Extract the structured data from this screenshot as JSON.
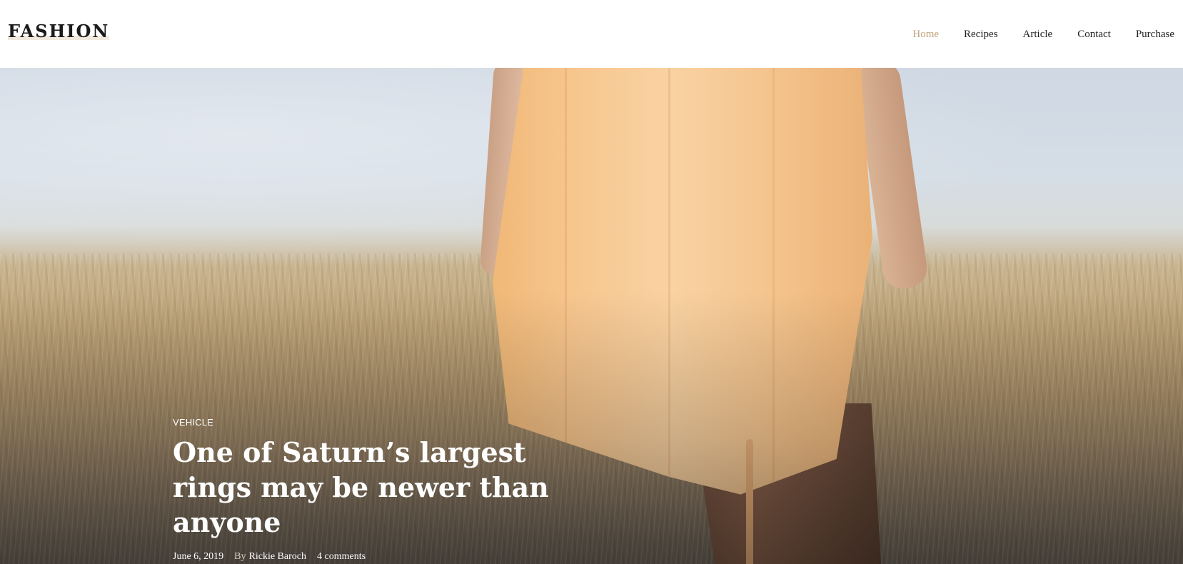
{
  "header": {
    "logo": "FASHION",
    "nav": [
      {
        "label": "Home",
        "active": true
      },
      {
        "label": "Recipes",
        "active": false
      },
      {
        "label": "Article",
        "active": false
      },
      {
        "label": "Contact",
        "active": false
      },
      {
        "label": "Purchase",
        "active": false
      }
    ]
  },
  "hero": {
    "category": "VEHICLE",
    "title": "One of Saturn’s largest rings may be newer than anyone",
    "date": "June 6, 2019",
    "by_label": "By",
    "author": "Rickie Baroch",
    "comments": "4 comments"
  },
  "colors": {
    "accent": "#c2a47e",
    "text": "#222222",
    "white": "#ffffff"
  }
}
